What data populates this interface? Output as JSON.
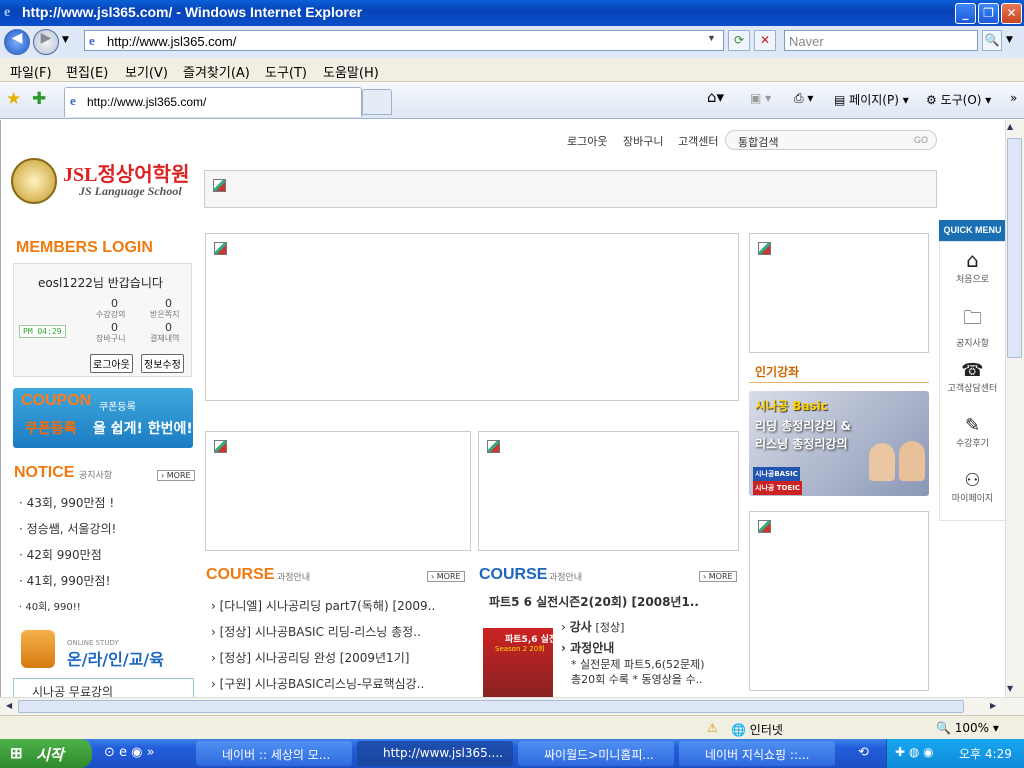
{
  "window": {
    "title": "http://www.jsl365.com/ - Windows Internet Explorer"
  },
  "address": {
    "url": "http://www.jsl365.com/",
    "search_placeholder": "Naver"
  },
  "menu": [
    "파일(F)",
    "편집(E)",
    "보기(V)",
    "즐겨찾기(A)",
    "도구(T)",
    "도움말(H)"
  ],
  "tab": {
    "label": "http://www.jsl365.com/"
  },
  "toolbar": {
    "page": "페이지(P)",
    "tools": "도구(O)"
  },
  "site": {
    "top_links": [
      "로그아웃",
      "장바구니",
      "고객센터"
    ],
    "search_placeholder": "통합검색",
    "search_go": "GO",
    "logo_main": "JSL정상어학원",
    "logo_sub": "JS Language School",
    "login": {
      "heading": "MEMBERS LOGIN",
      "greeting": "eosl1222님 반갑습니다",
      "time": "PM 04:29",
      "stats": [
        {
          "count": "0",
          "label": "수강강의"
        },
        {
          "count": "0",
          "label": "받은쪽지"
        },
        {
          "count": "0",
          "label": "장바구니"
        },
        {
          "count": "0",
          "label": "결제내역"
        }
      ],
      "logout": "로그아웃",
      "edit": "정보수정"
    },
    "coupon": {
      "title": "COUPON",
      "title_kr": "쿠폰등록",
      "text1": "쿠폰등록",
      "text2": "을 쉽게! 한번에!"
    },
    "notice": {
      "title": "NOTICE",
      "title_kr": "공지사항",
      "more": "MORE",
      "items": [
        "43회, 990만점 !",
        "정승쌤, 서울강의!",
        "42회 990만점",
        "41회, 990만점!",
        "40회, 990!!"
      ]
    },
    "online": {
      "sub": "ONLINE STUDY",
      "title": "온/라/인/교/육",
      "item": "시나공 무료강의"
    },
    "course_left": {
      "title": "COURSE",
      "title_kr": "과정안내",
      "more": "MORE",
      "items": [
        "[다니엘] 시나공리딩 part7(독해) [2009..",
        "[정상] 시나공BASIC 리딩-리스닝 총정..",
        "[정상] 시나공리딩 완성 [2009년1기]",
        "[구원] 시나공BASIC리스닝-무료핵심강.."
      ]
    },
    "course_right": {
      "title": "COURSE",
      "title_kr": "과정안내",
      "more": "MORE",
      "heading": "파트5 6 실전시즌2(20회) [2008년1..",
      "teacher_label": "강사",
      "teacher": "[정상]",
      "info_label": "과정안내",
      "desc1": "* 실전문제 파트5,6(52문제)",
      "desc2": "총20회 수록 * 동영상을 수..",
      "book_title": "파트5,6 실전",
      "book_sub": "Season 2 20회"
    },
    "popular": {
      "title": "인기강좌",
      "banner_l1": "시나공 Basic",
      "banner_l2": "리딩 총정리강의 &",
      "banner_l3": "리스닝 총정리강의",
      "badge1": "시나공BASIC",
      "badge2": "시나공 TOEIC"
    },
    "quick_menu": {
      "title": "QUICK MENU",
      "items": [
        "처음으로",
        "공지사항",
        "고객상담센터",
        "수강후기",
        "마이페이지"
      ]
    }
  },
  "status": {
    "zone": "인터넷",
    "zoom": "100%"
  },
  "taskbar": {
    "start": "시작",
    "tasks": [
      "네이버 :: 세상의 모...",
      "http://www.jsl365....",
      "싸이월드>미니홈피...",
      "네이버 지식쇼핑 ::..."
    ],
    "clock": "오후 4:29"
  }
}
